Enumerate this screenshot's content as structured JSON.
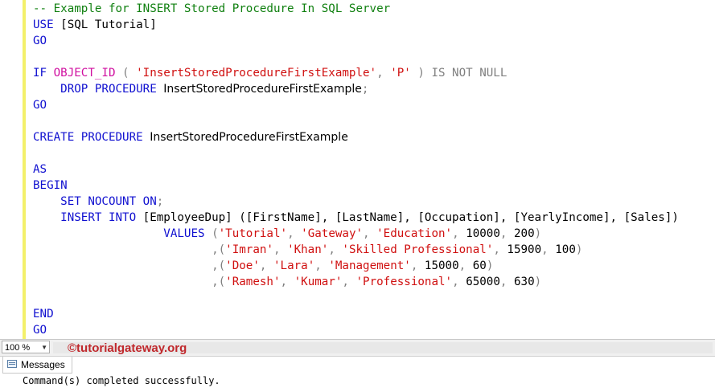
{
  "editor": {
    "lines": [
      [
        {
          "t": "-- Example for INSERT Stored Procedure In SQL Server",
          "c": "cmt"
        }
      ],
      [
        {
          "t": "USE ",
          "c": "kw"
        },
        {
          "t": "[SQL Tutorial]",
          "c": "blk"
        }
      ],
      [
        {
          "t": "GO",
          "c": "kw"
        }
      ],
      [],
      [
        {
          "t": "IF ",
          "c": "kw"
        },
        {
          "t": "OBJECT_ID",
          "c": "fn"
        },
        {
          "t": " ( ",
          "c": "gray"
        },
        {
          "t": "'InsertStoredProcedureFirstExample'",
          "c": "str"
        },
        {
          "t": ", ",
          "c": "gray"
        },
        {
          "t": "'P'",
          "c": "str"
        },
        {
          "t": " ) ",
          "c": "gray"
        },
        {
          "t": "IS NOT NULL",
          "c": "gray"
        }
      ],
      [
        {
          "t": "    DROP PROCEDURE ",
          "c": "kw"
        },
        {
          "t": "InsertStoredProcedureFirstExample",
          "c": "blk sans"
        },
        {
          "t": ";",
          "c": "gray"
        }
      ],
      [
        {
          "t": "GO",
          "c": "kw"
        }
      ],
      [],
      [
        {
          "t": "CREATE PROCEDURE ",
          "c": "kw"
        },
        {
          "t": "InsertStoredProcedureFirstExample",
          "c": "blk sans"
        }
      ],
      [],
      [
        {
          "t": "AS",
          "c": "kw"
        }
      ],
      [
        {
          "t": "BEGIN",
          "c": "kw"
        }
      ],
      [
        {
          "t": "    SET NOCOUNT ON",
          "c": "kw"
        },
        {
          "t": ";",
          "c": "gray"
        }
      ],
      [
        {
          "t": "    INSERT INTO ",
          "c": "kw"
        },
        {
          "t": "[EmployeeDup] ([FirstName], [LastName], [Occupation], [YearlyIncome], [Sales])",
          "c": "blk"
        }
      ],
      [
        {
          "t": "                   VALUES ",
          "c": "kw"
        },
        {
          "t": "(",
          "c": "gray"
        },
        {
          "t": "'Tutorial'",
          "c": "str"
        },
        {
          "t": ", ",
          "c": "gray"
        },
        {
          "t": "'Gateway'",
          "c": "str"
        },
        {
          "t": ", ",
          "c": "gray"
        },
        {
          "t": "'Education'",
          "c": "str"
        },
        {
          "t": ", ",
          "c": "gray"
        },
        {
          "t": "10000",
          "c": "blk"
        },
        {
          "t": ", ",
          "c": "gray"
        },
        {
          "t": "200",
          "c": "blk"
        },
        {
          "t": ")",
          "c": "gray"
        }
      ],
      [
        {
          "t": "                          ,(",
          "c": "gray"
        },
        {
          "t": "'Imran'",
          "c": "str"
        },
        {
          "t": ", ",
          "c": "gray"
        },
        {
          "t": "'Khan'",
          "c": "str"
        },
        {
          "t": ", ",
          "c": "gray"
        },
        {
          "t": "'Skilled Professional'",
          "c": "str"
        },
        {
          "t": ", ",
          "c": "gray"
        },
        {
          "t": "15900",
          "c": "blk"
        },
        {
          "t": ", ",
          "c": "gray"
        },
        {
          "t": "100",
          "c": "blk"
        },
        {
          "t": ")",
          "c": "gray"
        }
      ],
      [
        {
          "t": "                          ,(",
          "c": "gray"
        },
        {
          "t": "'Doe'",
          "c": "str"
        },
        {
          "t": ", ",
          "c": "gray"
        },
        {
          "t": "'Lara'",
          "c": "str"
        },
        {
          "t": ", ",
          "c": "gray"
        },
        {
          "t": "'Management'",
          "c": "str"
        },
        {
          "t": ", ",
          "c": "gray"
        },
        {
          "t": "15000",
          "c": "blk"
        },
        {
          "t": ", ",
          "c": "gray"
        },
        {
          "t": "60",
          "c": "blk"
        },
        {
          "t": ")",
          "c": "gray"
        }
      ],
      [
        {
          "t": "                          ,(",
          "c": "gray"
        },
        {
          "t": "'Ramesh'",
          "c": "str"
        },
        {
          "t": ", ",
          "c": "gray"
        },
        {
          "t": "'Kumar'",
          "c": "str"
        },
        {
          "t": ", ",
          "c": "gray"
        },
        {
          "t": "'Professional'",
          "c": "str"
        },
        {
          "t": ", ",
          "c": "gray"
        },
        {
          "t": "65000",
          "c": "blk"
        },
        {
          "t": ", ",
          "c": "gray"
        },
        {
          "t": "630",
          "c": "blk"
        },
        {
          "t": ")",
          "c": "gray"
        }
      ],
      [],
      [
        {
          "t": "END",
          "c": "kw"
        }
      ],
      [
        {
          "t": "GO",
          "c": "kw"
        }
      ]
    ]
  },
  "statusbar": {
    "zoom": "100 %",
    "watermark": "©tutorialgateway.org"
  },
  "results": {
    "tab_label": "Messages",
    "message": "Command(s) completed successfully."
  },
  "colors": {
    "keyword": "#1010d0",
    "string": "#d01010",
    "comment": "#108010",
    "function": "#d010a0",
    "operator": "#7f7f7f",
    "change_bar": "#f3f06a"
  }
}
